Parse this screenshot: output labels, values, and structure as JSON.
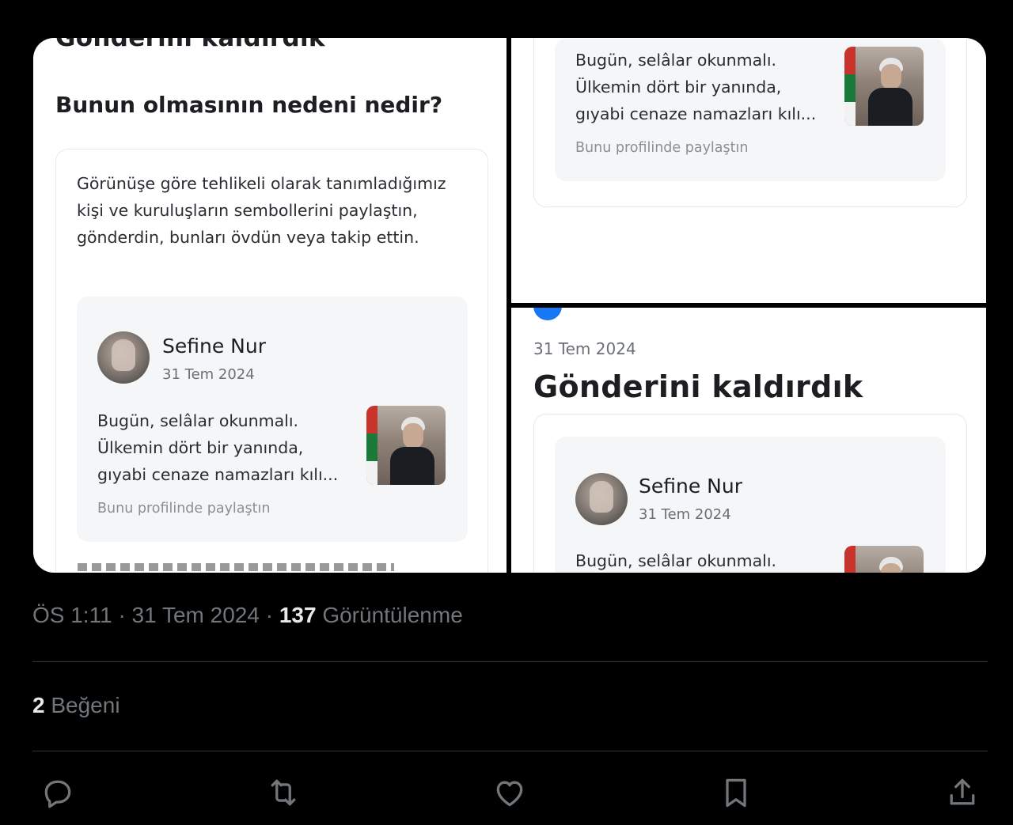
{
  "left_panel": {
    "cut_title": "Gönderini kaldırdık",
    "question": "Bunun olmasının nedeni nedir?",
    "reason": "Görünüşe göre tehlikeli olarak tanımladığımız kişi ve kuruluşların sembollerini paylaştın, gönderdin, bunları övdün veya takip ettin.",
    "post": {
      "author": "Sefine Nur",
      "date": "31 Tem 2024",
      "lines": [
        "Bugün, selâlar okunmalı.",
        "Ülkemin dört bir yanında,",
        "gıyabi cenaze namazları kılı..."
      ],
      "share_note": "Bunu profilinde paylaştın"
    }
  },
  "top_right_panel": {
    "lines": [
      "Bugün, selâlar okunmalı.",
      "Ülkemin dört bir yanında,",
      "gıyabi cenaze namazları kılı..."
    ],
    "share_note": "Bunu profilinde paylaştın"
  },
  "bottom_right_panel": {
    "date": "31 Tem 2024",
    "title": "Gönderini kaldırdık",
    "post": {
      "author": "Sefine Nur",
      "date": "31 Tem 2024",
      "first_line": "Bugün, selâlar okunmalı."
    }
  },
  "tweet_meta": {
    "time": "ÖS 1:11",
    "date": "31 Tem 2024",
    "views_count": "137",
    "views_label": "Görüntülenme"
  },
  "likes": {
    "count": "2",
    "label": "Beğeni"
  },
  "actions": [
    "reply-icon",
    "retweet-icon",
    "like-icon",
    "bookmark-icon",
    "share-icon"
  ],
  "colors": {
    "background": "#000000",
    "muted_text": "#71767b",
    "bright_text": "#e7e9ea",
    "divider": "#2f3336"
  }
}
